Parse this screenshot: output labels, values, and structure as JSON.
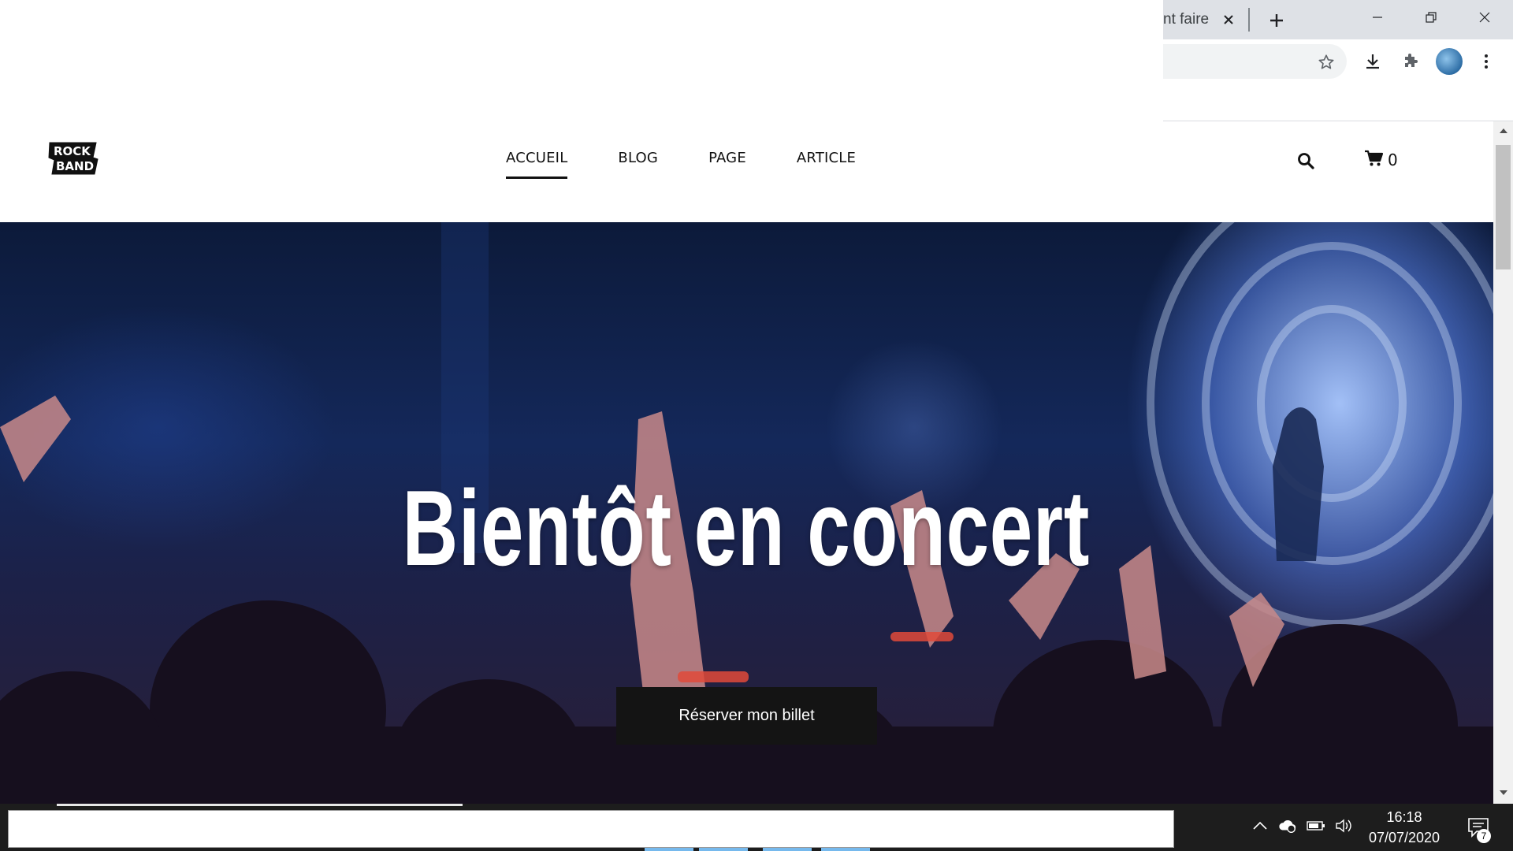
{
  "browser": {
    "tab_title_fragment": "nt faire",
    "window_controls": [
      "minimize-icon",
      "restore-icon",
      "close-icon"
    ],
    "toolbar_icons": [
      "star-icon",
      "download-icon",
      "extensions-icon",
      "profile-avatar",
      "menu-dots-icon"
    ]
  },
  "site": {
    "logo_alt": "ROCK BAND",
    "nav": [
      {
        "label": "ACCUEIL",
        "active": true
      },
      {
        "label": "BLOG",
        "active": false
      },
      {
        "label": "PAGE",
        "active": false
      },
      {
        "label": "ARTICLE",
        "active": false
      }
    ],
    "cart_count": "0"
  },
  "hero": {
    "title": "Bientôt en concert",
    "button_label": "Réserver mon billet"
  },
  "taskbar": {
    "time": "16:18",
    "date": "07/07/2020",
    "notification_count": "7",
    "tray_icons": [
      "chevron-up-icon",
      "onedrive-icon",
      "battery-icon",
      "volume-icon"
    ]
  },
  "colors": {
    "hero_button_bg": "#141414",
    "taskbar_bg": "#1d1d1d",
    "nav_text": "#111111"
  }
}
